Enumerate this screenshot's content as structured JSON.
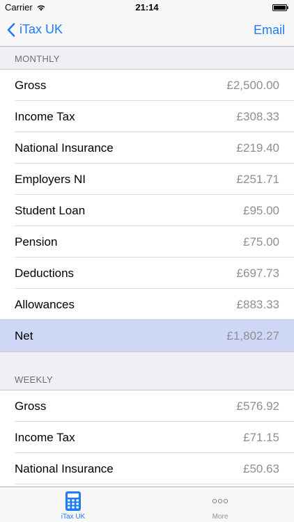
{
  "status_bar": {
    "carrier": "Carrier",
    "time": "21:14"
  },
  "nav": {
    "back_label": "iTax UK",
    "action_label": "Email",
    "accent_color": "#1e7cf6"
  },
  "sections": [
    {
      "header": "MONTHLY",
      "rows": [
        {
          "label": "Gross",
          "value": "£2,500.00"
        },
        {
          "label": "Income Tax",
          "value": "£308.33"
        },
        {
          "label": "National Insurance",
          "value": "£219.40"
        },
        {
          "label": "Employers NI",
          "value": "£251.71"
        },
        {
          "label": "Student Loan",
          "value": "£95.00"
        },
        {
          "label": "Pension",
          "value": "£75.00"
        },
        {
          "label": "Deductions",
          "value": "£697.73"
        },
        {
          "label": "Allowances",
          "value": "£883.33"
        },
        {
          "label": "Net",
          "value": "£1,802.27",
          "selected": true
        }
      ]
    },
    {
      "header": "WEEKLY",
      "rows": [
        {
          "label": "Gross",
          "value": "£576.92"
        },
        {
          "label": "Income Tax",
          "value": "£71.15"
        },
        {
          "label": "National Insurance",
          "value": "£50.63"
        },
        {
          "label": "",
          "value": ""
        }
      ]
    }
  ],
  "tab_bar": {
    "items": [
      {
        "label": "iTax UK",
        "icon": "calculator-icon",
        "active": true
      },
      {
        "label": "More",
        "icon": "more-dots-icon",
        "active": false
      }
    ]
  }
}
